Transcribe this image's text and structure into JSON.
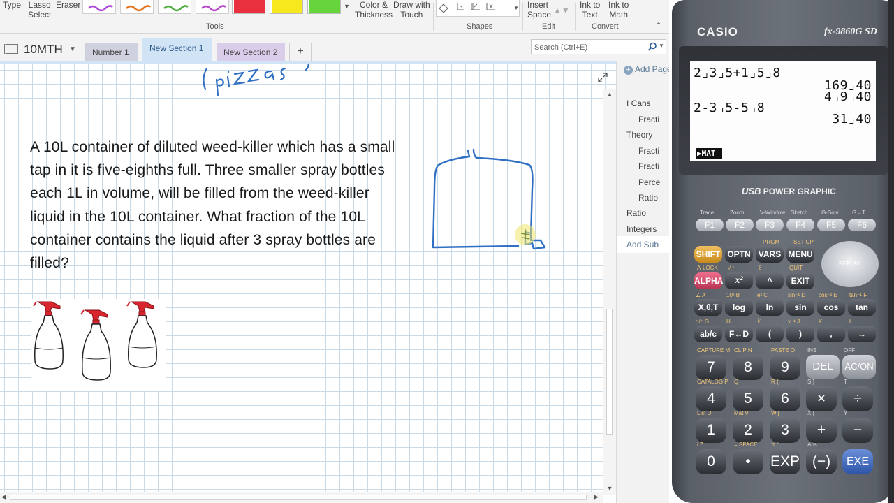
{
  "ribbon": {
    "type_label": "Type",
    "lasso_label_1": "Lasso",
    "lasso_label_2": "Select",
    "eraser_label": "Eraser",
    "color_thickness_1": "Color &",
    "color_thickness_2": "Thickness",
    "draw_touch_1": "Draw with",
    "draw_touch_2": "Touch",
    "insert_space_1": "Insert",
    "insert_space_2": "Space",
    "ink_text_1": "Ink to",
    "ink_text_2": "Text",
    "ink_math_1": "Ink to",
    "ink_math_2": "Math",
    "groups": {
      "tools": "Tools",
      "shapes": "Shapes",
      "edit": "Edit",
      "convert": "Convert"
    },
    "pen_colors": [
      "#b04bd6",
      "#e0731c",
      "#4caf3b",
      "#b648c9",
      "#e8303f",
      "#f7e81d",
      "#66d43b"
    ]
  },
  "notebook": {
    "name": "10MTH",
    "sections": [
      {
        "label": "Number 1",
        "color": "#cfd2de"
      },
      {
        "label": "New Section 1",
        "color": "#d1e4f5"
      },
      {
        "label": "New Section 2",
        "color": "#d9cdea"
      }
    ],
    "add_tab": "+"
  },
  "search": {
    "placeholder": "Search (Ctrl+E)"
  },
  "page": {
    "question": "A 10L container of diluted weed-killer which has a small tap in it is five-eighths full.  Three smaller spray bottles each 1L in volume, will be filled from the weed-killer liquid in the 10L container.  What fraction of the 10L container contains the liquid after 3 spray bottles are filled?",
    "ink_color": "#2f6fc4"
  },
  "pages_pane": {
    "add_page": "Add Page",
    "items": [
      {
        "label": "I Cans",
        "level": "top"
      },
      {
        "label": "Fracti",
        "level": "sub"
      },
      {
        "label": "Theory",
        "level": "top"
      },
      {
        "label": "Fracti",
        "level": "sub"
      },
      {
        "label": "Fracti",
        "level": "sub"
      },
      {
        "label": "Perce",
        "level": "sub"
      },
      {
        "label": "Ratio",
        "level": "sub"
      },
      {
        "label": "Ratio",
        "level": "top"
      },
      {
        "label": "Integers",
        "level": "top"
      }
    ],
    "add_subpage": "Add Sub"
  },
  "calculator": {
    "brand": "CASIO",
    "model": "fx-9860G SD",
    "usb_label_bold": "USB",
    "usb_label": "POWER GRAPHIC",
    "lcd": {
      "line1": "2⌟3⌟5+1⌟5⌟8",
      "result1a": "169⌟40",
      "result1b": "4⌟9⌟40",
      "line2": "2-3⌟5-5⌟8",
      "result2": "31⌟40",
      "menu_tab": "▶MAT"
    },
    "fkeys": [
      {
        "top": "Trace",
        "label": "F1"
      },
      {
        "top": "Zoom",
        "label": "F2"
      },
      {
        "top": "V-Window",
        "label": "F3"
      },
      {
        "top": "Sketch",
        "label": "F4"
      },
      {
        "top": "G-Solv",
        "label": "F5"
      },
      {
        "top": "G↔T",
        "label": "F6"
      }
    ],
    "row_shift": [
      "SHIFT",
      "OPTN",
      "VARS",
      "MENU"
    ],
    "row_shift_top": [
      "",
      "",
      "PRGM",
      "SET UP"
    ],
    "row_alpha": [
      "ALPHA",
      "x²",
      "^",
      "EXIT"
    ],
    "row_alpha_top": [
      "A-LOCK",
      "√  r",
      "θ",
      "QUIT"
    ],
    "replay": "REPLAY",
    "row_func": [
      "X,θ,T",
      "log",
      "ln",
      "sin",
      "cos",
      "tan"
    ],
    "row_func_top": [
      "∠     A",
      "10ˣ   B",
      "eˣ    C",
      "sin⁻¹  D",
      "cos⁻¹  E",
      "tan⁻¹  F"
    ],
    "row_frac": [
      "ab/c",
      "F↔D",
      "(",
      ")",
      ",",
      "→"
    ],
    "row_frac_top": [
      "d/c   G",
      "          H",
      "∛     I",
      "x⁻¹   J",
      "         K",
      "         L"
    ],
    "row_7": [
      "7",
      "8",
      "9",
      "DEL",
      "AC/ON"
    ],
    "row_7_top": [
      "CAPTURE  M",
      "CLIP  N",
      "PASTE  O",
      "INS",
      "OFF"
    ],
    "row_4": [
      "4",
      "5",
      "6",
      "×",
      "÷"
    ],
    "row_4_top": [
      "CATALOG  P",
      "Q",
      "R  {",
      "S  }",
      "T"
    ],
    "row_1": [
      "1",
      "2",
      "3",
      "+",
      "−"
    ],
    "row_1_top": [
      "List  U",
      "Mat  V",
      "W  [",
      "X  ]",
      "Y"
    ],
    "row_0": [
      "0",
      "•",
      "EXP",
      "(−)",
      "EXE"
    ],
    "row_0_top": [
      "i   Z",
      "=   SPACE",
      "π   \"",
      "Ans",
      ""
    ]
  }
}
